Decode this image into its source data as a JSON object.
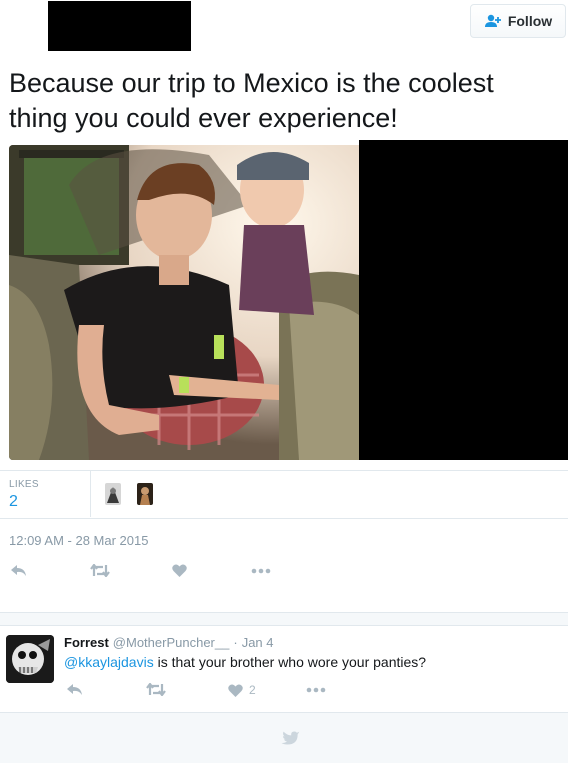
{
  "header": {
    "follow_label": "Follow"
  },
  "tweet": {
    "text": "Because our trip to Mexico is the coolest thing you could ever experience!",
    "likes_label": "LIKES",
    "likes_count": "2",
    "timestamp": "12:09 AM - 28 Mar 2015"
  },
  "reply": {
    "name": "Forrest",
    "handle": "@MotherPuncher__",
    "separator": "·",
    "date": "Jan 4",
    "mention": "@kkaylajdavis",
    "text": " is that your brother who wore your panties?",
    "like_count": "2"
  },
  "colors": {
    "accent": "#1b95e0",
    "muted": "#8899a6",
    "icon": "#aab8c2",
    "divider": "#e1e8ed"
  }
}
